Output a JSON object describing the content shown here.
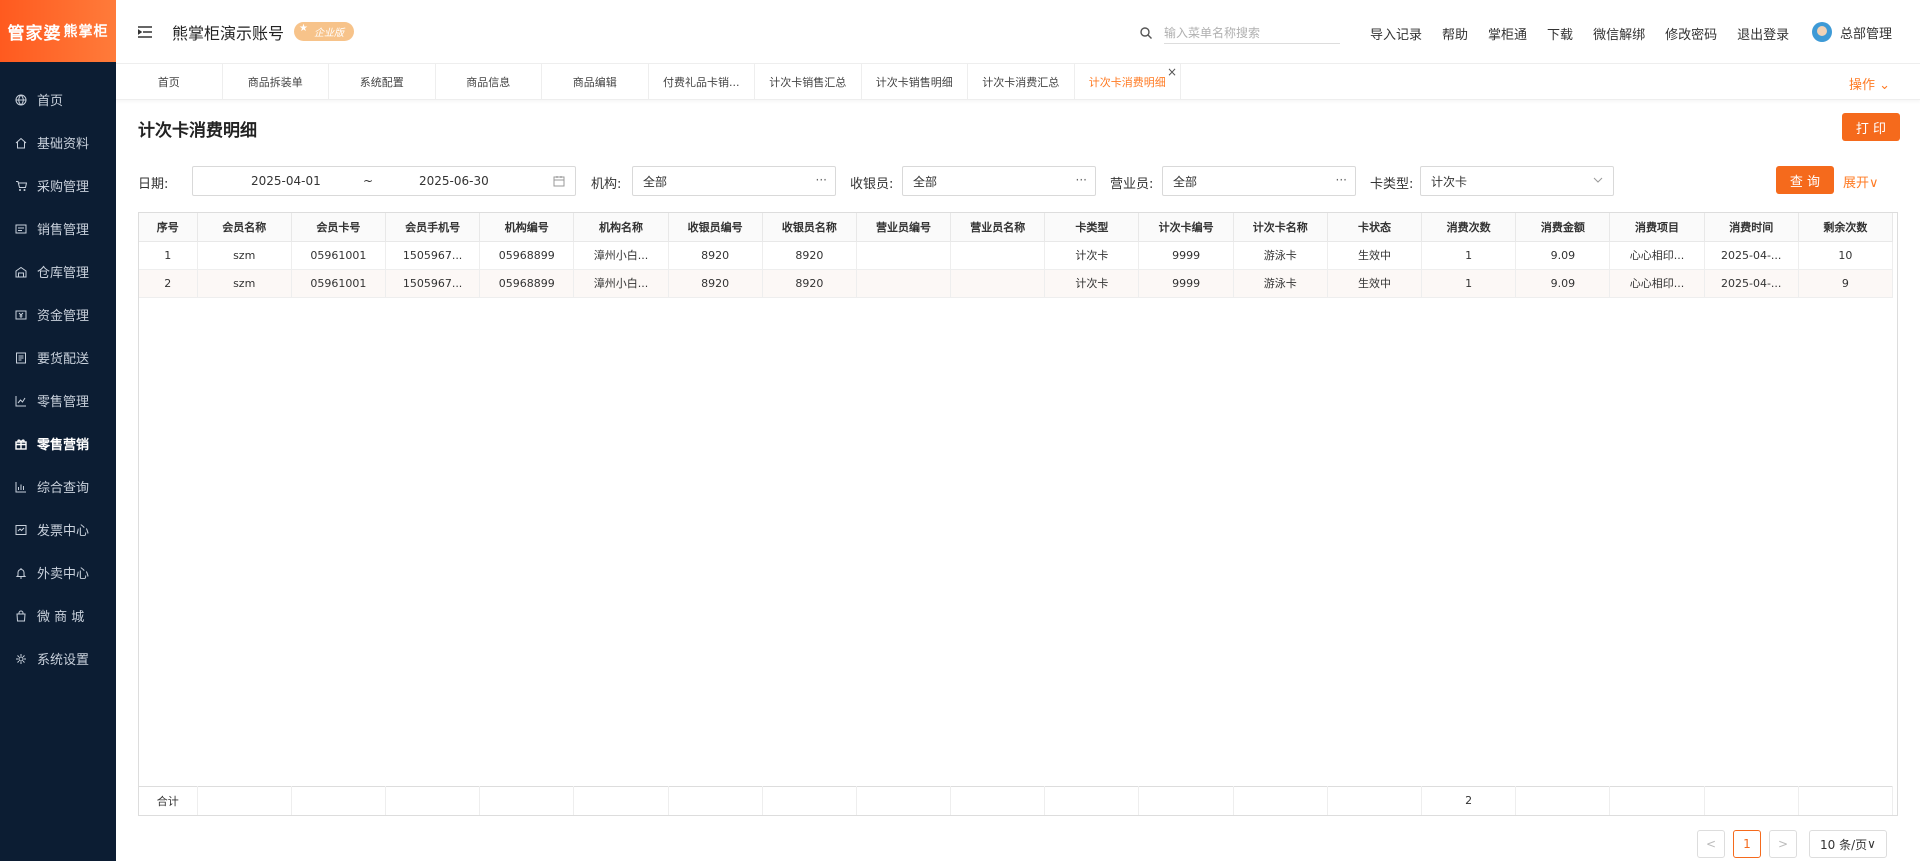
{
  "sidebar": {
    "logo_main": "管家婆",
    "logo_sub": "熊掌柜",
    "items": [
      {
        "label": "首页",
        "icon": "globe-icon",
        "active": false
      },
      {
        "label": "基础资料",
        "icon": "home-icon",
        "active": false
      },
      {
        "label": "采购管理",
        "icon": "cart-icon",
        "active": false
      },
      {
        "label": "销售管理",
        "icon": "receipt-icon",
        "active": false
      },
      {
        "label": "仓库管理",
        "icon": "warehouse-icon",
        "active": false
      },
      {
        "label": "资金管理",
        "icon": "money-icon",
        "active": false
      },
      {
        "label": "要货配送",
        "icon": "list-icon",
        "active": false
      },
      {
        "label": "零售管理",
        "icon": "line-chart-icon",
        "active": false
      },
      {
        "label": "零售营销",
        "icon": "gift-icon",
        "active": true
      },
      {
        "label": "综合查询",
        "icon": "bar-chart-icon",
        "active": false
      },
      {
        "label": "发票中心",
        "icon": "invoice-icon",
        "active": false
      },
      {
        "label": "外卖中心",
        "icon": "bell-icon",
        "active": false
      },
      {
        "label": "微 商 城",
        "icon": "shop-icon",
        "active": false
      },
      {
        "label": "系统设置",
        "icon": "gear-icon",
        "active": false
      }
    ]
  },
  "header": {
    "account": "熊掌柜演示账号",
    "edition_badge": "企业版",
    "search_placeholder": "输入菜单名称搜索",
    "links": [
      "导入记录",
      "帮助",
      "掌柜通",
      "下载",
      "微信解绑",
      "修改密码",
      "退出登录"
    ],
    "user_name": "总部管理"
  },
  "tabs": {
    "items": [
      "首页",
      "商品拆装单",
      "系统配置",
      "商品信息",
      "商品编辑",
      "付费礼品卡销...",
      "计次卡销售汇总",
      "计次卡销售明细",
      "计次卡消费汇总",
      "计次卡消费明细"
    ],
    "active_index": 9,
    "operations_label": "操作"
  },
  "page": {
    "title": "计次卡消费明细",
    "print_label": "打 印",
    "query_label": "查 询",
    "expand_label": "展开"
  },
  "filters": {
    "date_label": "日期:",
    "date_start": "2025-04-01",
    "date_sep": "~",
    "date_end": "2025-06-30",
    "org_label": "机构:",
    "org_value": "全部",
    "cashier_label": "收银员:",
    "cashier_value": "全部",
    "sales_label": "营业员:",
    "sales_value": "全部",
    "card_type_label": "卡类型:",
    "card_type_value": "计次卡"
  },
  "table": {
    "columns": [
      "序号",
      "会员名称",
      "会员卡号",
      "会员手机号",
      "机构编号",
      "机构名称",
      "收银员编号",
      "收银员名称",
      "营业员编号",
      "营业员名称",
      "卡类型",
      "计次卡编号",
      "计次卡名称",
      "卡状态",
      "消费次数",
      "消费金额",
      "消费项目",
      "消费时间",
      "剩余次数"
    ],
    "rows": [
      [
        "1",
        "szm",
        "05961001",
        "1505967...",
        "05968899",
        "漳州小白...",
        "8920",
        "8920",
        "",
        "",
        "计次卡",
        "9999",
        "游泳卡",
        "生效中",
        "1",
        "9.09",
        "心心相印...",
        "2025-04-...",
        "10"
      ],
      [
        "2",
        "szm",
        "05961001",
        "1505967...",
        "05968899",
        "漳州小白...",
        "8920",
        "8920",
        "",
        "",
        "计次卡",
        "9999",
        "游泳卡",
        "生效中",
        "1",
        "9.09",
        "心心相印...",
        "2025-04-...",
        "9"
      ]
    ],
    "total_label": "合计",
    "total_count": "2"
  },
  "pagination": {
    "prev": "<",
    "current": "1",
    "next": ">",
    "page_size": "10 条/页"
  },
  "colors": {
    "accent": "#f56a1c",
    "sidebar_bg": "#0c1d33"
  }
}
